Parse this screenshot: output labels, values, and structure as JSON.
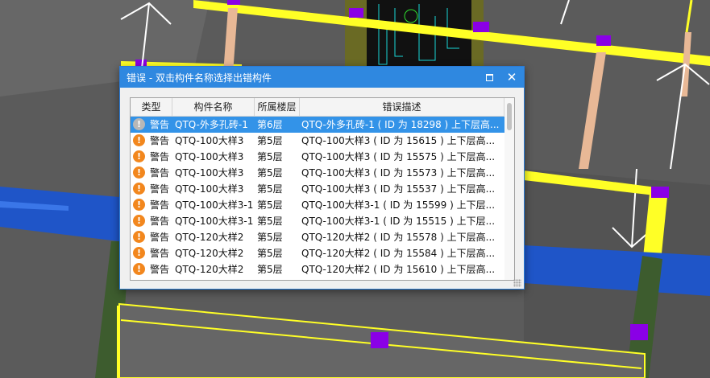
{
  "dialog": {
    "title": "错误 - 双击构件名称选择出错构件",
    "maximize_icon": "maximize-icon",
    "close_label": "✕"
  },
  "table": {
    "headers": [
      "类型",
      "构件名称",
      "所属楼层",
      "错误描述"
    ],
    "rows": [
      {
        "icon": "warning-icon",
        "type": "警告",
        "name": "QTQ-外多孔砖-1",
        "floor": "第6层",
        "desc": "QTQ-外多孔砖-1 ( ID 为 18298 ) 上下层高...",
        "selected": true
      },
      {
        "icon": "warning-icon",
        "type": "警告",
        "name": "QTQ-100大样3",
        "floor": "第5层",
        "desc": "QTQ-100大样3 ( ID 为 15615 ) 上下层高...",
        "selected": false
      },
      {
        "icon": "warning-icon",
        "type": "警告",
        "name": "QTQ-100大样3",
        "floor": "第5层",
        "desc": "QTQ-100大样3 ( ID 为 15575 ) 上下层高...",
        "selected": false
      },
      {
        "icon": "warning-icon",
        "type": "警告",
        "name": "QTQ-100大样3",
        "floor": "第5层",
        "desc": "QTQ-100大样3 ( ID 为 15573 ) 上下层高...",
        "selected": false
      },
      {
        "icon": "warning-icon",
        "type": "警告",
        "name": "QTQ-100大样3",
        "floor": "第5层",
        "desc": "QTQ-100大样3 ( ID 为 15537 ) 上下层高...",
        "selected": false
      },
      {
        "icon": "warning-icon",
        "type": "警告",
        "name": "QTQ-100大样3-1",
        "floor": "第5层",
        "desc": "QTQ-100大样3-1 ( ID 为 15599 ) 上下层...",
        "selected": false
      },
      {
        "icon": "warning-icon",
        "type": "警告",
        "name": "QTQ-100大样3-1",
        "floor": "第5层",
        "desc": "QTQ-100大样3-1 ( ID 为 15515 ) 上下层...",
        "selected": false
      },
      {
        "icon": "warning-icon",
        "type": "警告",
        "name": "QTQ-120大样2",
        "floor": "第5层",
        "desc": "QTQ-120大样2 ( ID 为 15578 ) 上下层高...",
        "selected": false
      },
      {
        "icon": "warning-icon",
        "type": "警告",
        "name": "QTQ-120大样2",
        "floor": "第5层",
        "desc": "QTQ-120大样2 ( ID 为 15584 ) 上下层高...",
        "selected": false
      },
      {
        "icon": "warning-icon",
        "type": "警告",
        "name": "QTQ-120大样2",
        "floor": "第5层",
        "desc": "QTQ-120大样2 ( ID 为 15610 ) 上下层高...",
        "selected": false
      }
    ]
  },
  "colors": {
    "viewport_bg": "#5b5b5b",
    "beam_yellow": "#ffff26",
    "column_purple": "#8a00e6",
    "slab_blue": "#1f55c8",
    "titlebar_blue": "#2f88e0",
    "selection_blue": "#3393e8",
    "warning_orange": "#f2871e"
  }
}
